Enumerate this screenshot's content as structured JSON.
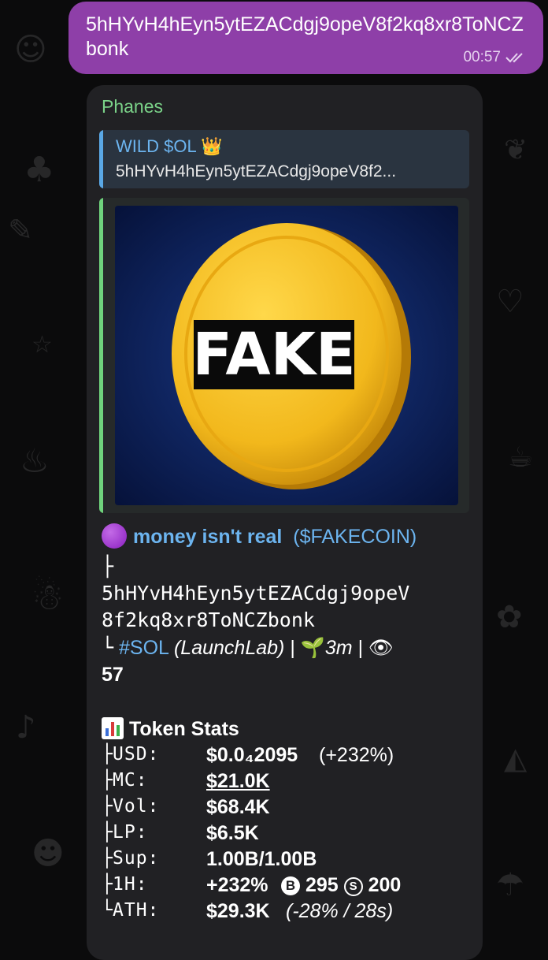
{
  "outgoing": {
    "text": "5hHYvH4hEyn5ytEZACdgj9opeV8f2kq8xr8ToNCZbonk",
    "time": "00:57"
  },
  "incoming": {
    "sender": "Phanes",
    "reply": {
      "title": "WILD $OL 👑",
      "text": "5hHYvH4hEyn5ytEZACdgj9opeV8f2..."
    },
    "media_label": "FAKE",
    "token": {
      "name": "money isn't real",
      "ticker": "($FAKECOIN)",
      "address_line1": "5hHYvH4hEyn5ytEZACdgj9opeV",
      "address_line2": "8f2kq8xr8ToNCZbonk",
      "chain_tag": "#SOL",
      "platform": "(LaunchLab)",
      "age": "3m",
      "views": "57"
    },
    "stats": {
      "header": "Token Stats",
      "rows": [
        {
          "label": "USD:",
          "value": "$0.0₄2095",
          "extra": "(+232%)"
        },
        {
          "label": "MC:",
          "value": "$21.0K",
          "extra": ""
        },
        {
          "label": "Vol:",
          "value": "$68.4K",
          "extra": ""
        },
        {
          "label": "LP:",
          "value": "$6.5K",
          "extra": ""
        },
        {
          "label": "Sup:",
          "value": "1.00B/1.00B",
          "extra": ""
        },
        {
          "label": "1H:",
          "value": "+232%",
          "buys": "295",
          "sells": "200"
        },
        {
          "label": "ATH:",
          "value": "$29.3K",
          "extra": "(-28% / 28s)"
        }
      ],
      "buy_icon": "B",
      "sell_icon": "S"
    }
  },
  "colors": {
    "outgoing_bubble": "#8e3fa8",
    "incoming_bubble": "#212124",
    "sender_name": "#7bd389",
    "link": "#6cb4ef",
    "coin_gold": "#f2b81c"
  }
}
